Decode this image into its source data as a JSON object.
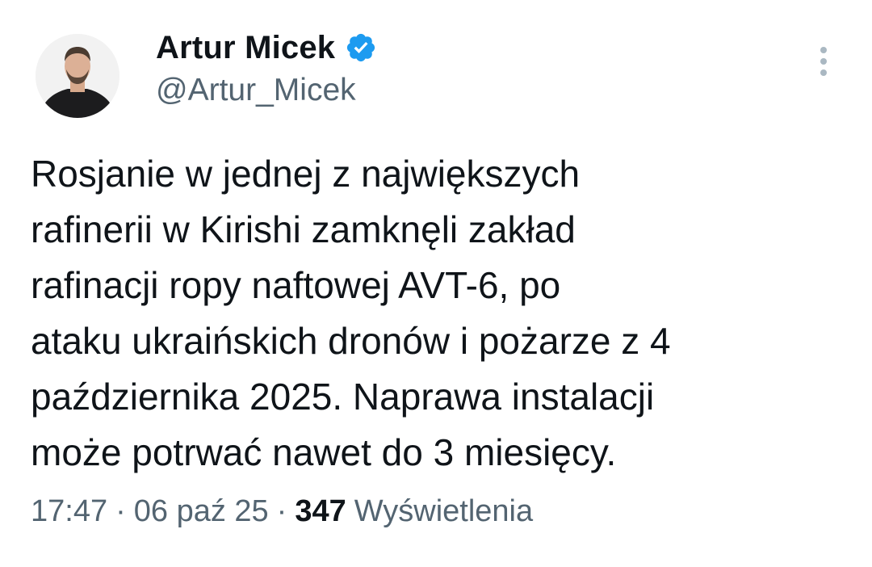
{
  "tweet": {
    "author": {
      "display_name": "Artur Micek",
      "handle": "@Artur_Micek",
      "verified_icon": "verified-badge-icon"
    },
    "text": "Rosjanie w jednej z największych\nrafinerii w Kirishi zamknęli zakład\nrafinacji ropy naftowej AVT-6, po\nataku ukraińskich dronów i pożarze z 4\npaździernika 2025. Naprawa instalacji\nmoże potrwać nawet do 3 miesięcy.",
    "meta": {
      "time": "17:47",
      "separator": "·",
      "date": "06 paź 25",
      "views_count": "347",
      "views_label": "Wyświetlenia"
    },
    "more_icon": "more-vertical-icon"
  },
  "colors": {
    "text_primary": "#0f1419",
    "text_secondary": "#536471",
    "verified_blue": "#1d9bf0",
    "more_icon": "#aab8c2"
  }
}
